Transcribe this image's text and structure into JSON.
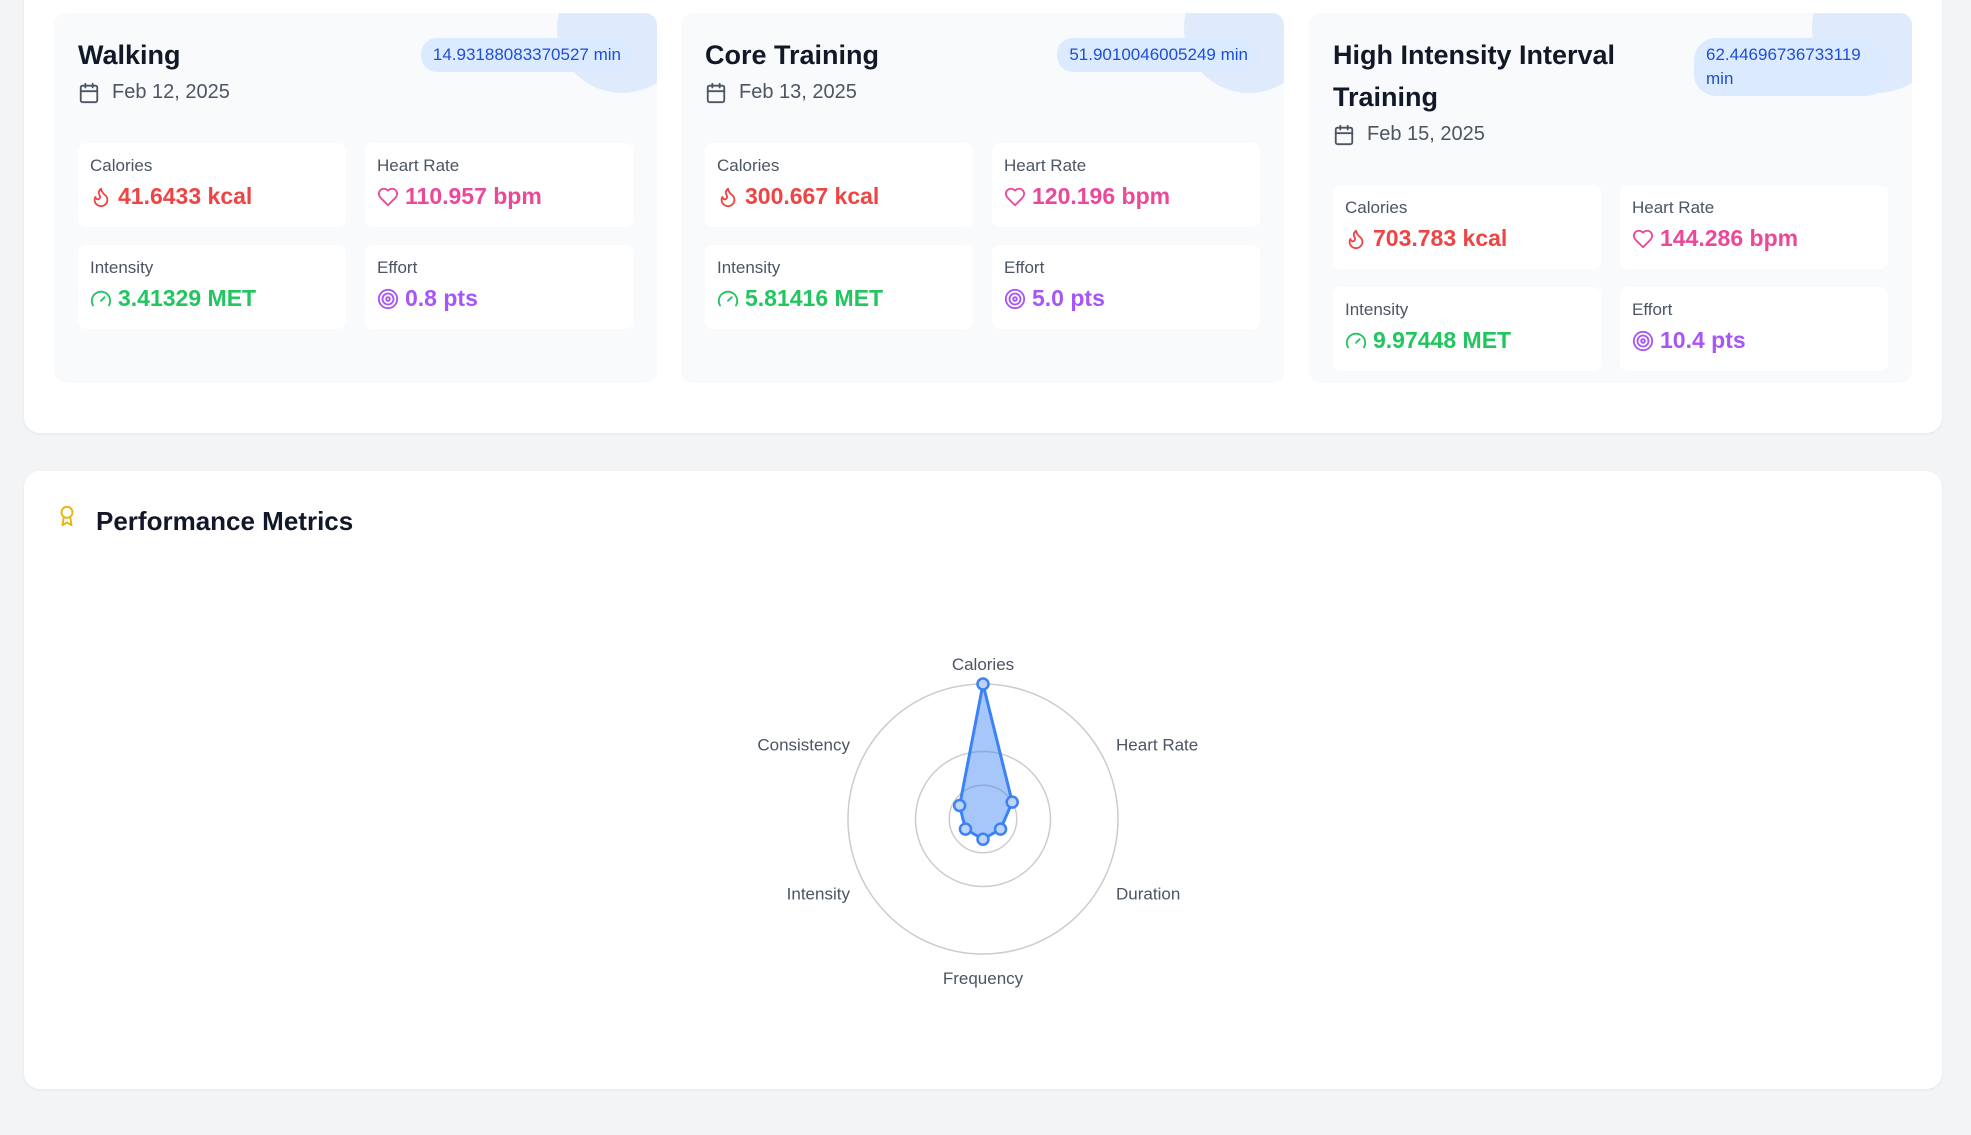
{
  "workouts": [
    {
      "name": "Walking",
      "duration": "14.93188083370527 min",
      "date": "Feb 12, 2025",
      "calories": {
        "label": "Calories",
        "value": "41.6433 kcal"
      },
      "heart_rate": {
        "label": "Heart Rate",
        "value": "110.957 bpm"
      },
      "intensity": {
        "label": "Intensity",
        "value": "3.41329 MET"
      },
      "effort": {
        "label": "Effort",
        "value": "0.8 pts"
      }
    },
    {
      "name": "Core Training",
      "duration": "51.9010046005249 min",
      "date": "Feb 13, 2025",
      "calories": {
        "label": "Calories",
        "value": "300.667 kcal"
      },
      "heart_rate": {
        "label": "Heart Rate",
        "value": "120.196 bpm"
      },
      "intensity": {
        "label": "Intensity",
        "value": "5.81416 MET"
      },
      "effort": {
        "label": "Effort",
        "value": "5.0 pts"
      }
    },
    {
      "name": "High Intensity Interval Training",
      "duration": "62.44696736733119 min",
      "date": "Feb 15, 2025",
      "calories": {
        "label": "Calories",
        "value": "703.783 kcal"
      },
      "heart_rate": {
        "label": "Heart Rate",
        "value": "144.286 bpm"
      },
      "intensity": {
        "label": "Intensity",
        "value": "9.97448 MET"
      },
      "effort": {
        "label": "Effort",
        "value": "10.4 pts"
      }
    }
  ],
  "performance": {
    "title": "Performance Metrics"
  },
  "colors": {
    "calories": "#ef4444",
    "heart_rate": "#ec4899",
    "intensity": "#22c55e",
    "effort": "#a855f7",
    "accent": "#3b82f6",
    "badge_bg": "#dbeafe",
    "award": "#eab308"
  },
  "chart_data": {
    "type": "radar",
    "axes": [
      "Calories",
      "Heart Rate",
      "Duration",
      "Frequency",
      "Intensity",
      "Consistency"
    ],
    "values": [
      1.0,
      0.25,
      0.15,
      0.15,
      0.15,
      0.2
    ],
    "rings": 3,
    "grid": true,
    "legend": "none"
  }
}
